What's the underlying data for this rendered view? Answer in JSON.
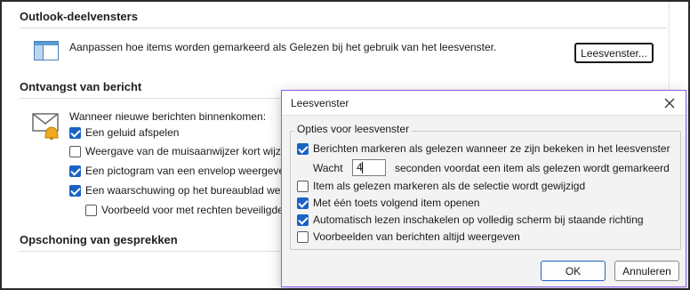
{
  "outlook_panes": {
    "title": "Outlook-deelvensters",
    "description": "Aanpassen hoe items worden gemarkeerd als Gelezen bij het gebruik van het leesvenster.",
    "button_label": "Leesvenster..."
  },
  "message_arrival": {
    "title": "Ontvangst van bericht",
    "intro": "Wanneer nieuwe berichten binnenkomen:",
    "options": [
      {
        "label": "Een geluid afspelen",
        "checked": true
      },
      {
        "label": "Weergave van de muisaanwijzer kort wijzig",
        "checked": false
      },
      {
        "label": "Een pictogram van een envelop weergever",
        "checked": true
      },
      {
        "label": "Een waarschuwing op het bureaublad weer",
        "checked": true
      }
    ],
    "sub_option": {
      "label": "Voorbeeld voor met rechten beveiligde",
      "checked": false
    }
  },
  "cleanup": {
    "title": "Opschoning van gesprekken"
  },
  "dialog": {
    "title": "Leesvenster",
    "close_icon": "close-icon",
    "group_title": "Opties voor leesvenster",
    "mark_read_option": {
      "label": "Berichten markeren als gelezen wanneer ze zijn bekeken in het leesvenster",
      "checked": true
    },
    "wait_label": "Wacht",
    "wait_value": "4",
    "wait_suffix": "seconden voordat een item als gelezen wordt gemarkeerd",
    "options": [
      {
        "label": "Item als gelezen markeren als de selectie wordt gewijzigd",
        "checked": false
      },
      {
        "label": "Met één toets volgend item openen",
        "checked": true
      },
      {
        "label": "Automatisch lezen inschakelen op volledig scherm bij staande richting",
        "checked": true
      },
      {
        "label": "Voorbeelden van berichten altijd weergeven",
        "checked": false
      }
    ],
    "ok_label": "OK",
    "cancel_label": "Annuleren"
  },
  "colors": {
    "accent": "#1a63c4",
    "dialog_border": "#8b5cf6"
  }
}
